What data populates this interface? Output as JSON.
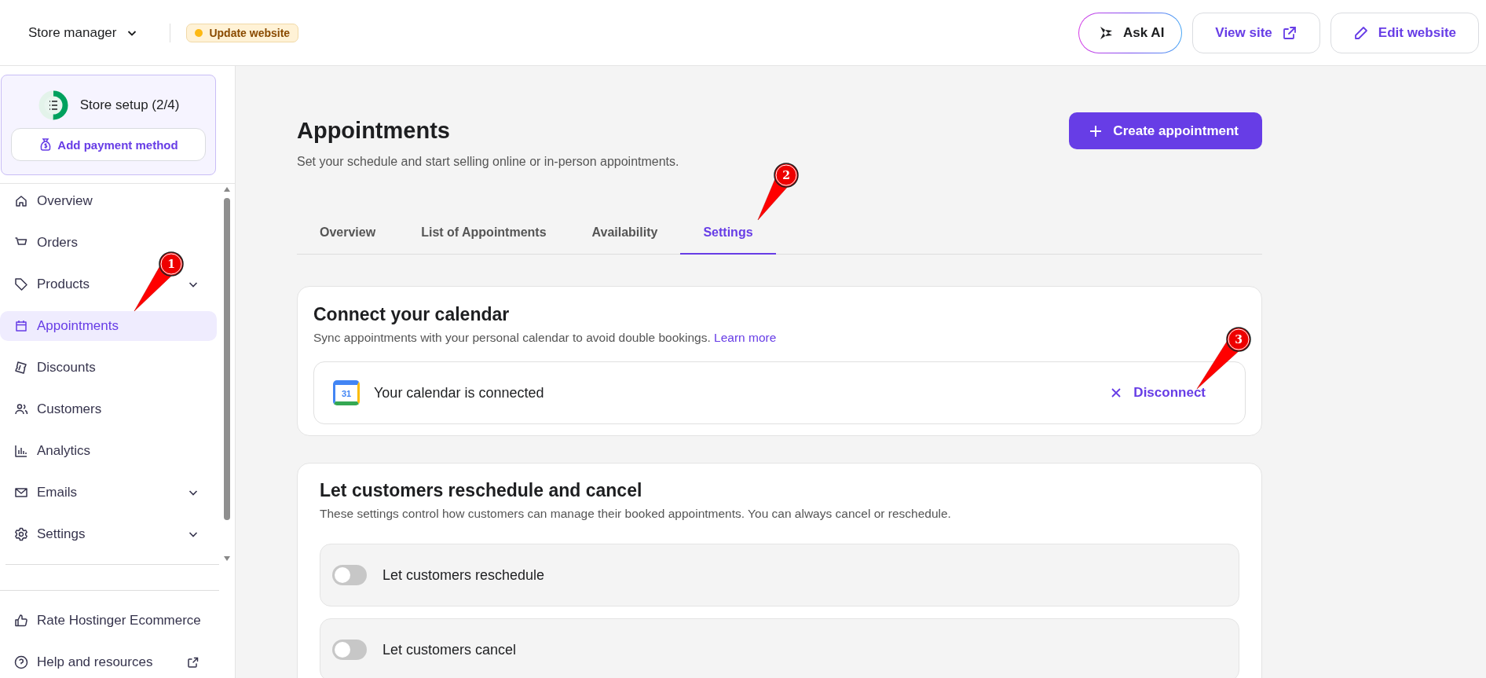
{
  "topbar": {
    "store_menu": {
      "label": "Store manager"
    },
    "badge": {
      "label": "Update website",
      "color": "#fdb913"
    },
    "buttons": [
      {
        "kind": "ai",
        "label": "Ask AI"
      },
      {
        "kind": "view",
        "label": "View site"
      },
      {
        "kind": "edit",
        "label": "Edit website"
      }
    ]
  },
  "sidebar": {
    "setup": {
      "label": "Store setup (2/4)",
      "level": 0.5,
      "button": "Add payment method"
    },
    "items": [
      {
        "label": "Overview",
        "selected": false,
        "has_submenu": false
      },
      {
        "label": "Orders",
        "selected": false,
        "has_submenu": false
      },
      {
        "label": "Products",
        "selected": false,
        "has_submenu": true
      },
      {
        "label": "Appointments",
        "selected": true,
        "has_submenu": false
      },
      {
        "label": "Discounts",
        "selected": false,
        "has_submenu": false
      },
      {
        "label": "Customers",
        "selected": false,
        "has_submenu": false
      },
      {
        "label": "Analytics",
        "selected": false,
        "has_submenu": false
      },
      {
        "label": "Emails",
        "selected": false,
        "has_submenu": true
      },
      {
        "label": "Settings",
        "selected": false,
        "has_submenu": true
      }
    ],
    "footer_items": [
      {
        "label": "Rate Hostinger Ecommerce",
        "external": false
      },
      {
        "label": "Help and resources",
        "external": true
      }
    ]
  },
  "page": {
    "title": "Appointments",
    "subtitle": "Set your schedule and start selling online or in-person appointments.",
    "create_button": "Create appointment",
    "tabs": [
      {
        "label": "Overview",
        "selected": false
      },
      {
        "label": "List of Appointments",
        "selected": false
      },
      {
        "label": "Availability",
        "selected": false
      },
      {
        "label": "Settings",
        "selected": true
      }
    ],
    "calendar_card": {
      "title": "Connect your calendar",
      "description": "Sync appointments with your personal calendar to avoid double bookings.",
      "link": "Learn more",
      "status": "Your calendar is connected",
      "calendar_icon_text": "31",
      "action": "Disconnect"
    },
    "reschedule_card": {
      "title": "Let customers reschedule and cancel",
      "description": "These settings control how customers can manage their booked appointments. You can always cancel or reschedule.",
      "toggles": [
        {
          "label": "Let customers reschedule",
          "on": false
        },
        {
          "label": "Let customers cancel",
          "on": false
        }
      ]
    }
  },
  "callouts": [
    {
      "number": "1"
    },
    {
      "number": "2"
    },
    {
      "number": "3"
    }
  ]
}
